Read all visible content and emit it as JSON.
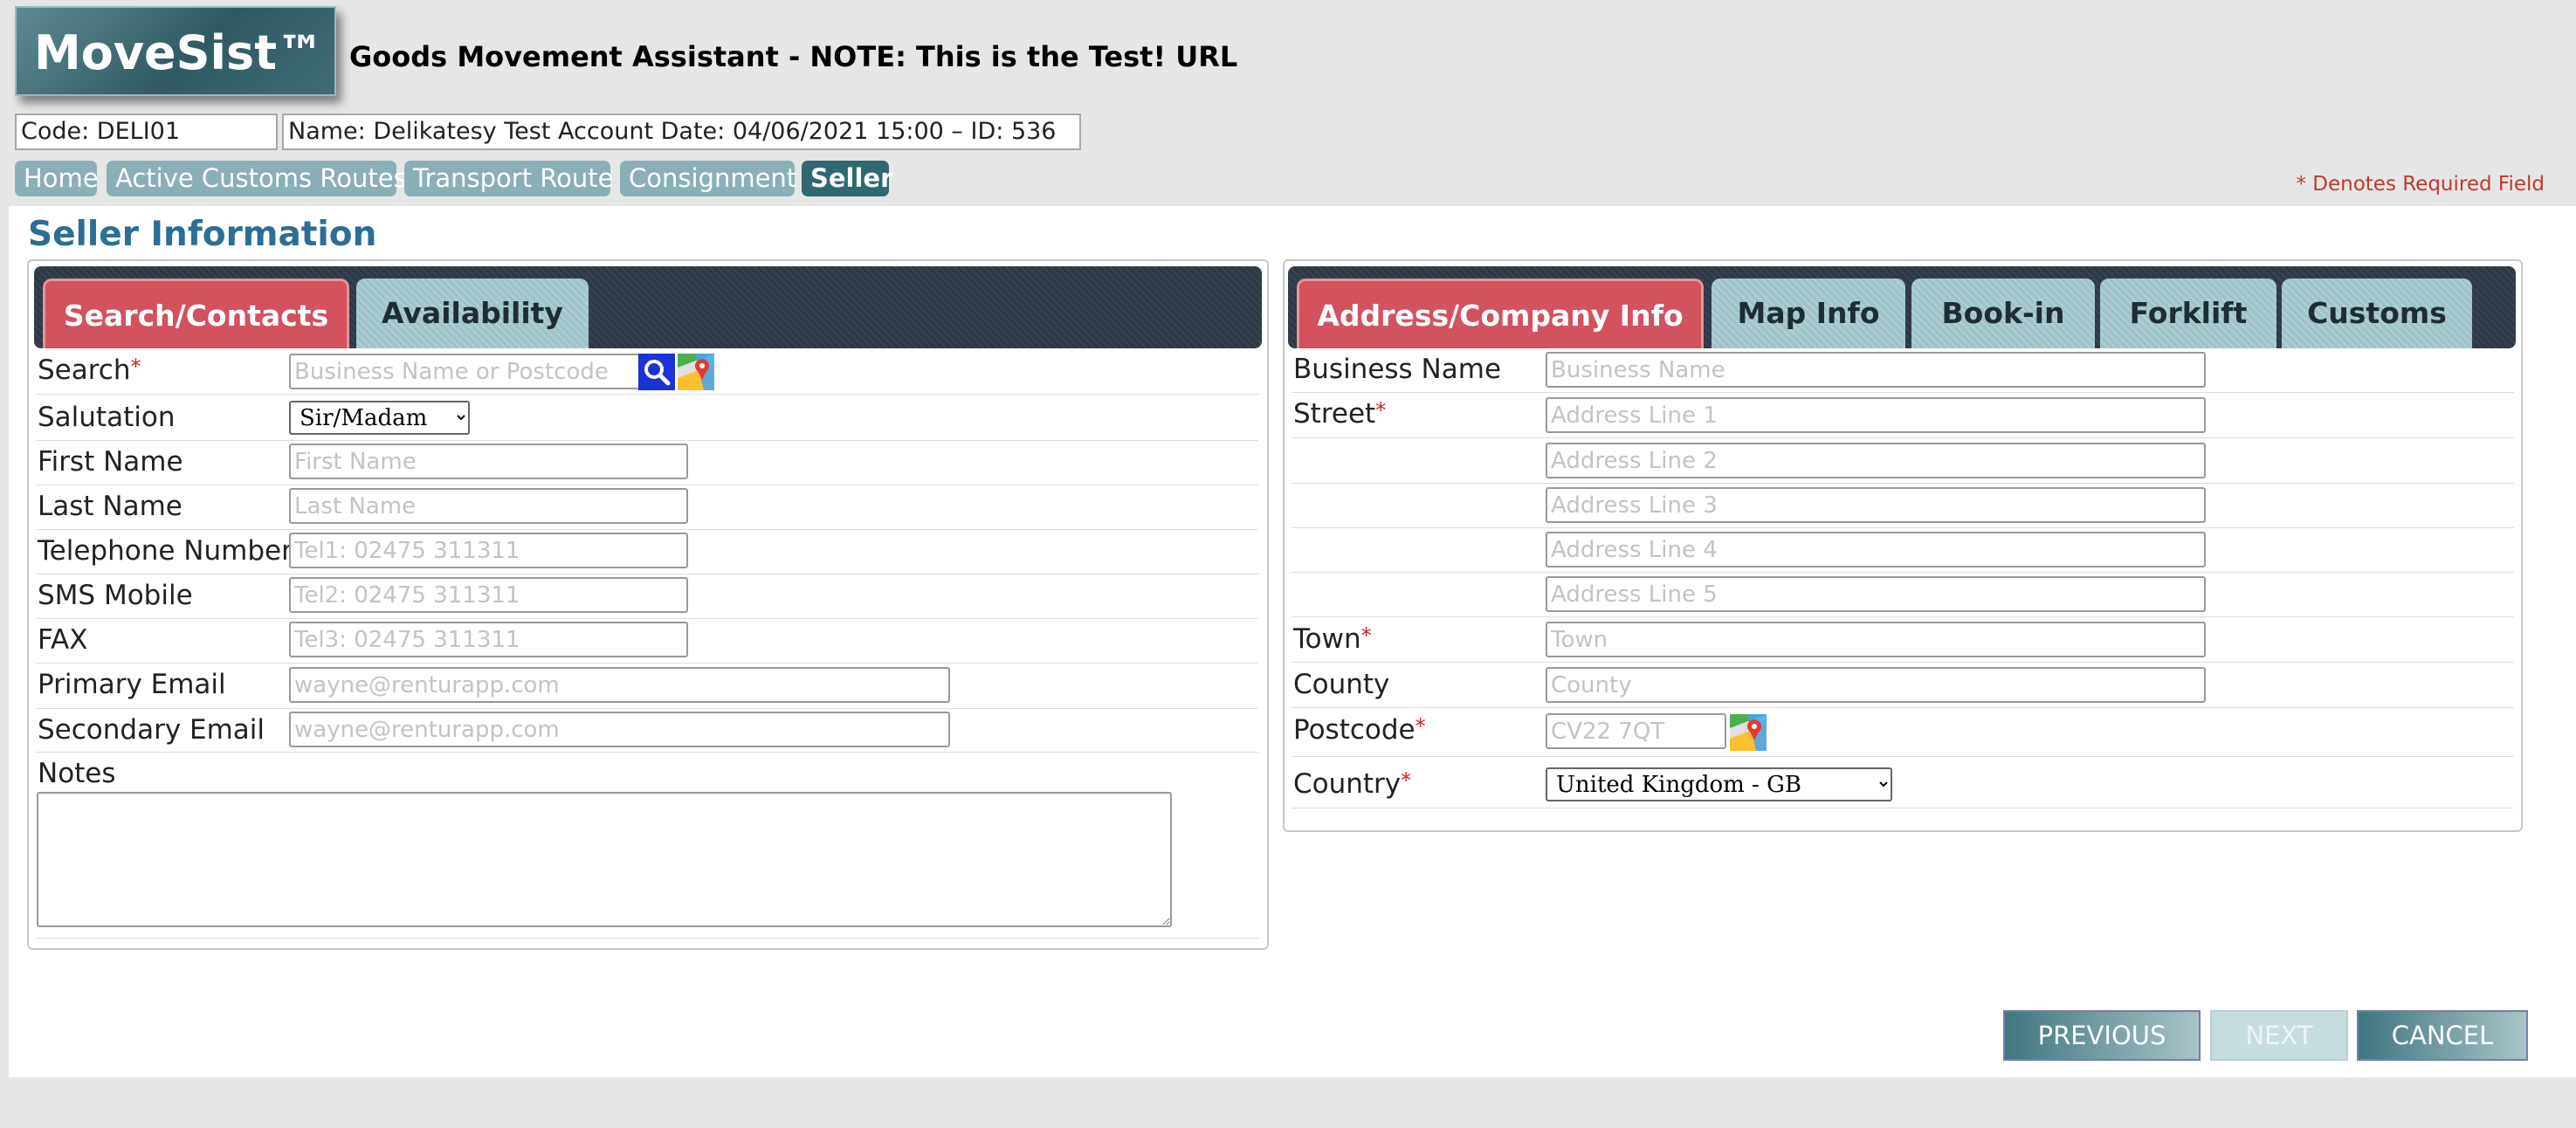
{
  "app": {
    "logo": "MoveSist™",
    "title": "Goods Movement Assistant - NOTE: This is the Test! URL"
  },
  "account": {
    "code": "Code: DELI01",
    "details": "Name: Delikatesy Test Account Date: 04/06/2021 15:00 – ID: 536"
  },
  "nav": {
    "items": [
      "Home",
      "Active Customs Routes",
      "Transport Route",
      "Consignment",
      "Seller"
    ],
    "active": "Seller"
  },
  "required_note": "* Denotes Required Field",
  "page_title": "Seller Information",
  "left_panel": {
    "tabs": [
      "Search/Contacts",
      "Availability"
    ],
    "active_tab": "Search/Contacts",
    "fields": {
      "search": {
        "label": "Search",
        "placeholder": "Business Name or Postcode"
      },
      "salutation": {
        "label": "Salutation",
        "value": "Sir/Madam"
      },
      "first_name": {
        "label": "First Name",
        "placeholder": "First Name"
      },
      "last_name": {
        "label": "Last Name",
        "placeholder": "Last Name"
      },
      "telephone": {
        "label": "Telephone Number",
        "placeholder": "Tel1: 02475 311311"
      },
      "sms": {
        "label": "SMS Mobile",
        "placeholder": "Tel2: 02475 311311"
      },
      "fax": {
        "label": "FAX",
        "placeholder": "Tel3: 02475 311311"
      },
      "primary_email": {
        "label": "Primary Email",
        "placeholder": "wayne@renturapp.com"
      },
      "secondary_email": {
        "label": "Secondary Email",
        "placeholder": "wayne@renturapp.com"
      },
      "notes": {
        "label": "Notes"
      }
    }
  },
  "right_panel": {
    "tabs": [
      "Address/Company Info",
      "Map Info",
      "Book-in",
      "Forklift",
      "Customs"
    ],
    "active_tab": "Address/Company Info",
    "fields": {
      "business_name": {
        "label": "Business Name",
        "placeholder": "Business Name"
      },
      "street": {
        "label": "Street",
        "placeholders": [
          "Address Line 1",
          "Address Line 2",
          "Address Line 3",
          "Address Line 4",
          "Address Line 5"
        ]
      },
      "town": {
        "label": "Town",
        "placeholder": "Town"
      },
      "county": {
        "label": "County",
        "placeholder": "County"
      },
      "postcode": {
        "label": "Postcode",
        "placeholder": "CV22 7QT"
      },
      "country": {
        "label": "Country",
        "value": "United Kingdom - GB"
      }
    }
  },
  "buttons": {
    "previous": "PREVIOUS",
    "next": "NEXT",
    "cancel": "CANCEL"
  },
  "icons": {
    "search": "search-icon",
    "map": "google-maps-icon"
  },
  "colors": {
    "active_tab": "#d2525e",
    "inactive_tab": "#9fc3c8",
    "tab_bar": "#2e3947",
    "nav_item": "#8ab0b7",
    "nav_active": "#2f6870",
    "title_blue": "#2b6e96",
    "required": "#d21f1f"
  }
}
